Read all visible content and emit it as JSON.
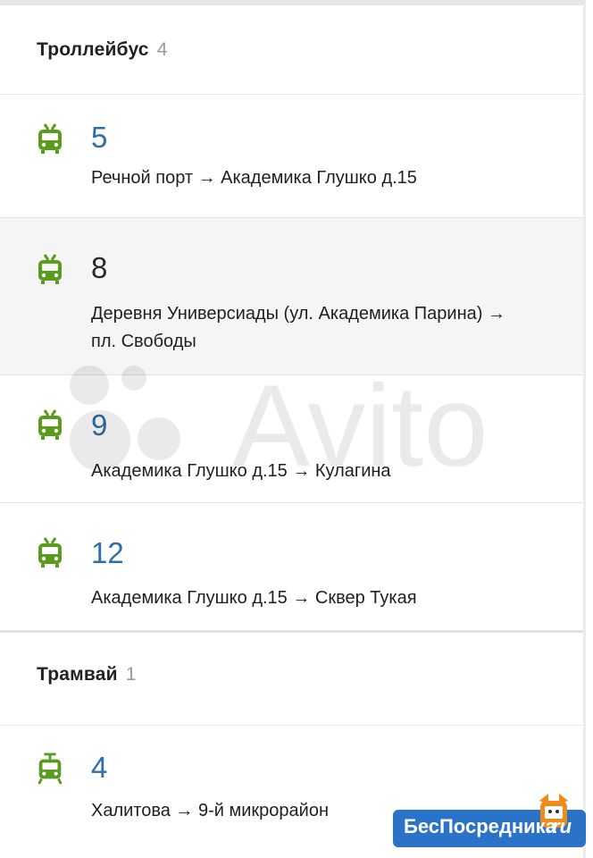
{
  "sections": [
    {
      "title": "Троллейбус",
      "count": "4",
      "routes": [
        {
          "number": "5",
          "direction": "Речной порт → Академика Глушко д.15",
          "icon": "trolleybus-icon"
        },
        {
          "number": "8",
          "direction": "Деревня Универсиады (ул. Академика Парина) → пл. Свободы",
          "icon": "trolleybus-icon"
        },
        {
          "number": "9",
          "direction": "Академика Глушко д.15 → Кулагина",
          "icon": "trolleybus-icon"
        },
        {
          "number": "12",
          "direction": "Академика Глушко д.15 → Сквер Тукая",
          "icon": "trolleybus-icon"
        }
      ]
    },
    {
      "title": "Трамвай",
      "count": "1",
      "routes": [
        {
          "number": "4",
          "direction": "Халитова → 9-й микрорайон",
          "icon": "tram-icon"
        }
      ]
    }
  ],
  "watermark": "Avito",
  "logo": {
    "text": "БесПосредника",
    "suffix": ".ru"
  },
  "colors": {
    "route_number_link": "#2f6ea8",
    "route_number_selected": "#2a2a2a",
    "transport_icon": "#5a9c1e",
    "highlight_row": "#f5f5f5",
    "logo_bg": "#2a73c6"
  }
}
